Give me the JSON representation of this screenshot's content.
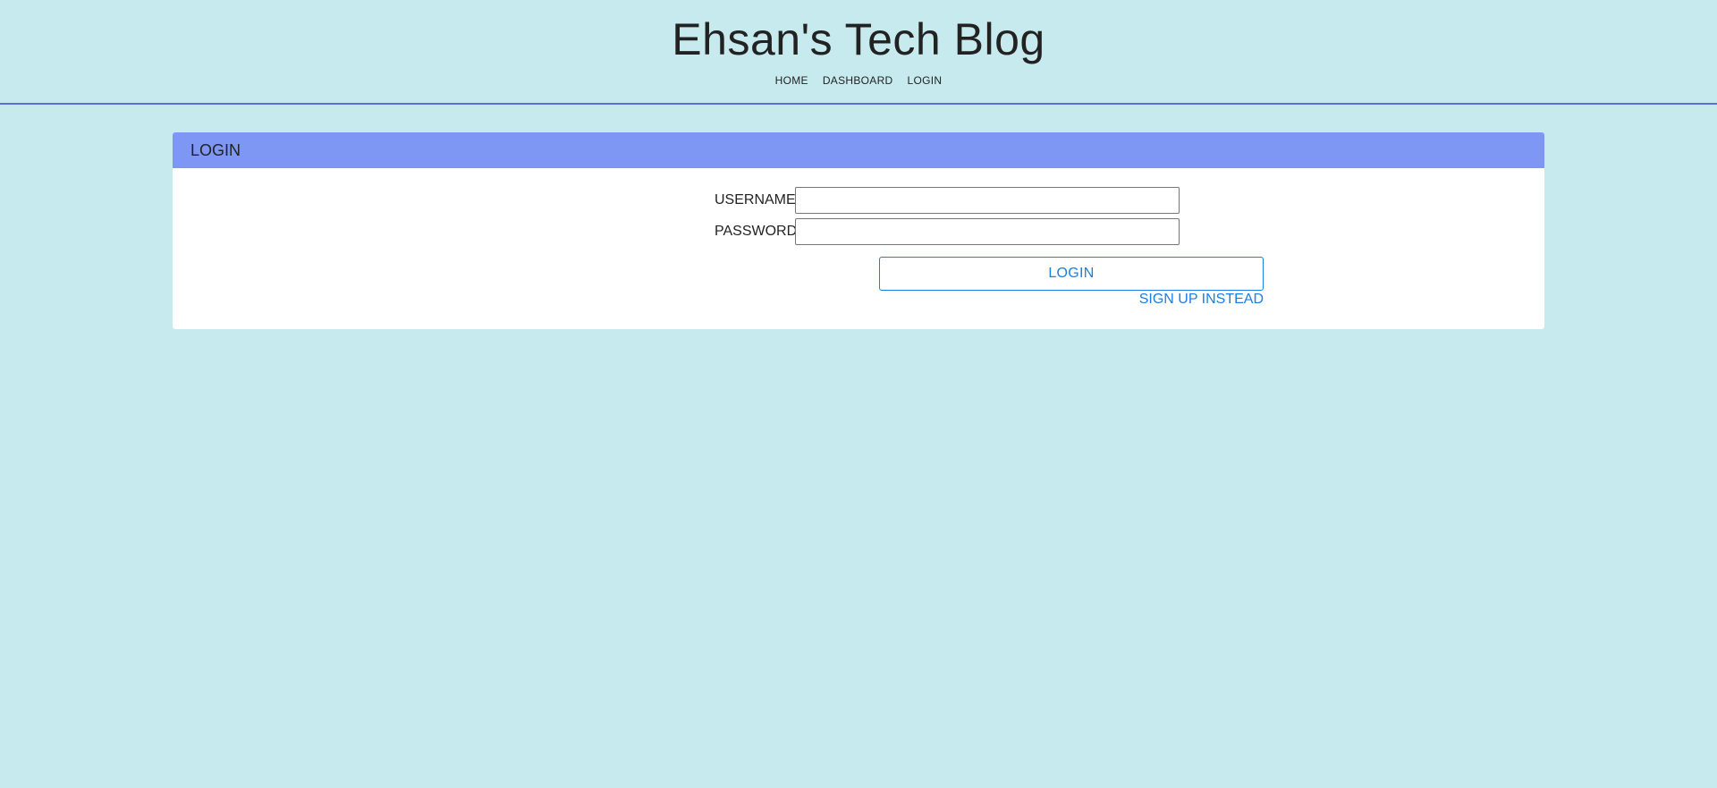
{
  "header": {
    "title": "Ehsan's Tech Blog",
    "nav": [
      {
        "label": "HOME"
      },
      {
        "label": "DASHBOARD"
      },
      {
        "label": "LOGIN"
      }
    ]
  },
  "login_card": {
    "title": "LOGIN",
    "username": {
      "label": "USERNAME:",
      "value": "",
      "placeholder": ""
    },
    "password": {
      "label": "PASSWORD:",
      "value": "",
      "placeholder": ""
    },
    "submit_label": "LOGIN",
    "signup_label": "SIGN UP INSTEAD"
  },
  "colors": {
    "background": "#c7eaee",
    "card_header": "#7e97f5",
    "accent": "#1a7fe0",
    "header_rule": "#5a6fd6"
  }
}
